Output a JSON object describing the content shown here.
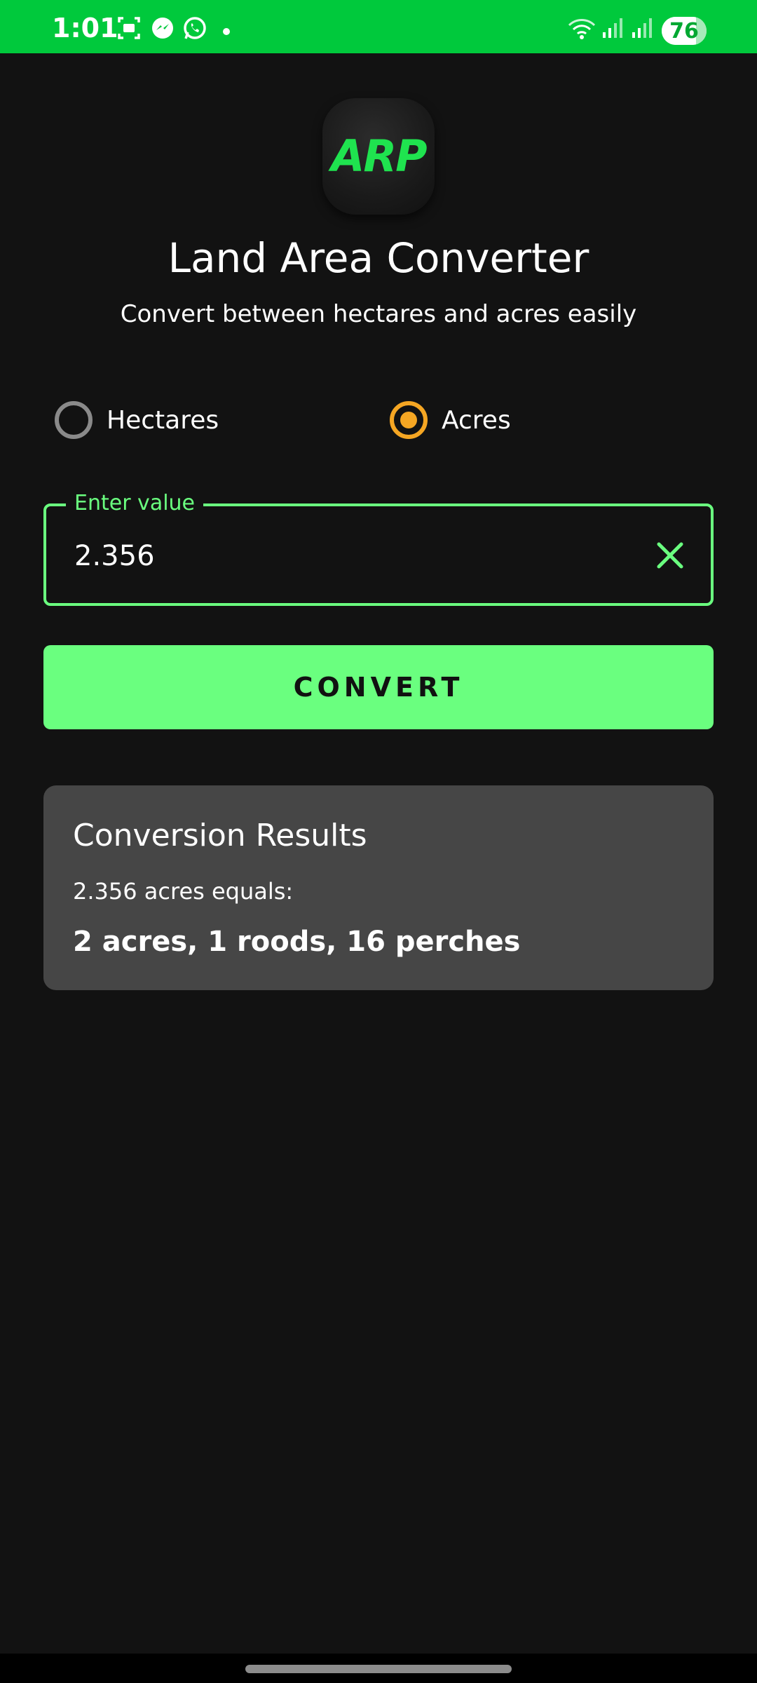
{
  "status_bar": {
    "time": "1:01",
    "icons": [
      "screenshot-icon",
      "messenger-icon",
      "whatsapp-icon",
      "notification-dot-icon",
      "wifi-icon",
      "signal-icon",
      "signal-icon-2"
    ],
    "battery_level": "76",
    "battery_fraction": 0.76,
    "background_color": "#00c93c"
  },
  "app": {
    "logo_text": "ARP",
    "title": "Land Area Converter",
    "subtitle": "Convert between hectares and acres easily"
  },
  "unit_options": [
    {
      "label": "Hectares",
      "selected": false
    },
    {
      "label": "Acres",
      "selected": true
    }
  ],
  "input": {
    "label": "Enter value",
    "value": "2.356"
  },
  "convert_button": {
    "label": "CONVERT"
  },
  "results": {
    "title": "Conversion Results",
    "equals_line": "2.356 acres equals:",
    "result": "2 acres, 1 roods, 16 perches"
  },
  "colors": {
    "accent": "#6aff7f",
    "radio_selected": "#f5a623",
    "background": "#121212",
    "card": "#464646"
  }
}
